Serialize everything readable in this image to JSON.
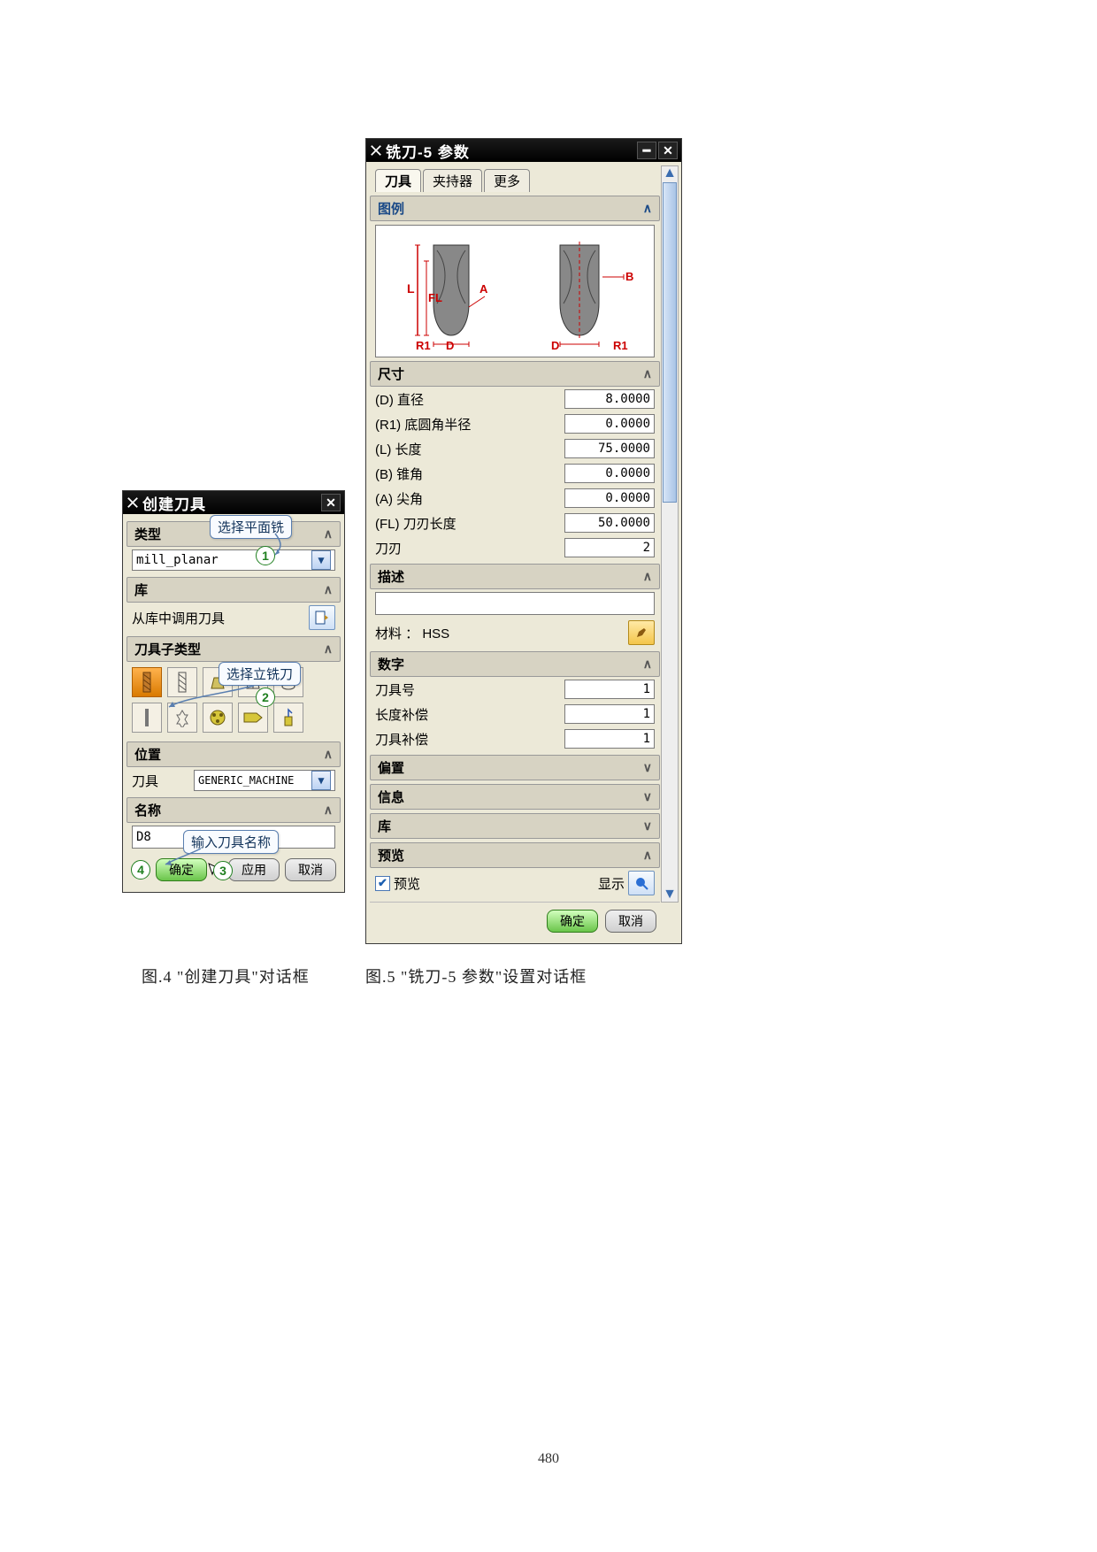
{
  "dlg1": {
    "title": "创建刀具",
    "sec_type": "类型",
    "combo_type": "mill_planar",
    "sec_lib": "库",
    "lib_label": "从库中调用刀具",
    "sec_subtype": "刀具子类型",
    "sec_pos": "位置",
    "pos_tool_label": "刀具",
    "pos_tool_value": "GENERIC_MACHINE",
    "name_label": "名称",
    "name_value": "D8",
    "btn_ok": "确定",
    "btn_apply": "应用",
    "btn_cancel": "取消",
    "callout1": "选择平面铣",
    "callout2": "选择立铣刀",
    "callout3": "输入刀具名称",
    "num1": "1",
    "num2": "2",
    "num3": "3",
    "num4": "4"
  },
  "dlg2": {
    "title": "铣刀-5 参数",
    "tab_tool": "刀具",
    "tab_holder": "夹持器",
    "tab_more": "更多",
    "sec_diagram": "图例",
    "diag_labels": {
      "L": "L",
      "FL": "FL",
      "A": "A",
      "B": "B",
      "R1a": "R1",
      "D1": "D",
      "D2": "D",
      "R1b": "R1"
    },
    "sec_dim": "尺寸",
    "rows": {
      "d": {
        "l": "(D) 直径",
        "v": "8.0000"
      },
      "r1": {
        "l": "(R1) 底圆角半径",
        "v": "0.0000"
      },
      "l": {
        "l": "(L) 长度",
        "v": "75.0000"
      },
      "b": {
        "l": "(B) 锥角",
        "v": "0.0000"
      },
      "a": {
        "l": "(A) 尖角",
        "v": "0.0000"
      },
      "fl": {
        "l": "(FL) 刀刃长度",
        "v": "50.0000"
      },
      "flutes": {
        "l": "刀刃",
        "v": "2"
      }
    },
    "sec_desc": "描述",
    "material_label": "材料 ： HSS",
    "sec_num": "数字",
    "num_rows": {
      "tn": {
        "l": "刀具号",
        "v": "1"
      },
      "lo": {
        "l": "长度补偿",
        "v": "1"
      },
      "to": {
        "l": "刀具补偿",
        "v": "1"
      }
    },
    "sec_offset": "偏置",
    "sec_info": "信息",
    "sec_lib": "库",
    "sec_preview": "预览",
    "preview_chk": "预览",
    "preview_show": "显示",
    "btn_ok": "确定",
    "btn_cancel": "取消"
  },
  "caption1": "图.4  \"创建刀具\"对话框",
  "caption2": "图.5  \"铣刀-5 参数\"设置对话框",
  "pagenum": "480"
}
